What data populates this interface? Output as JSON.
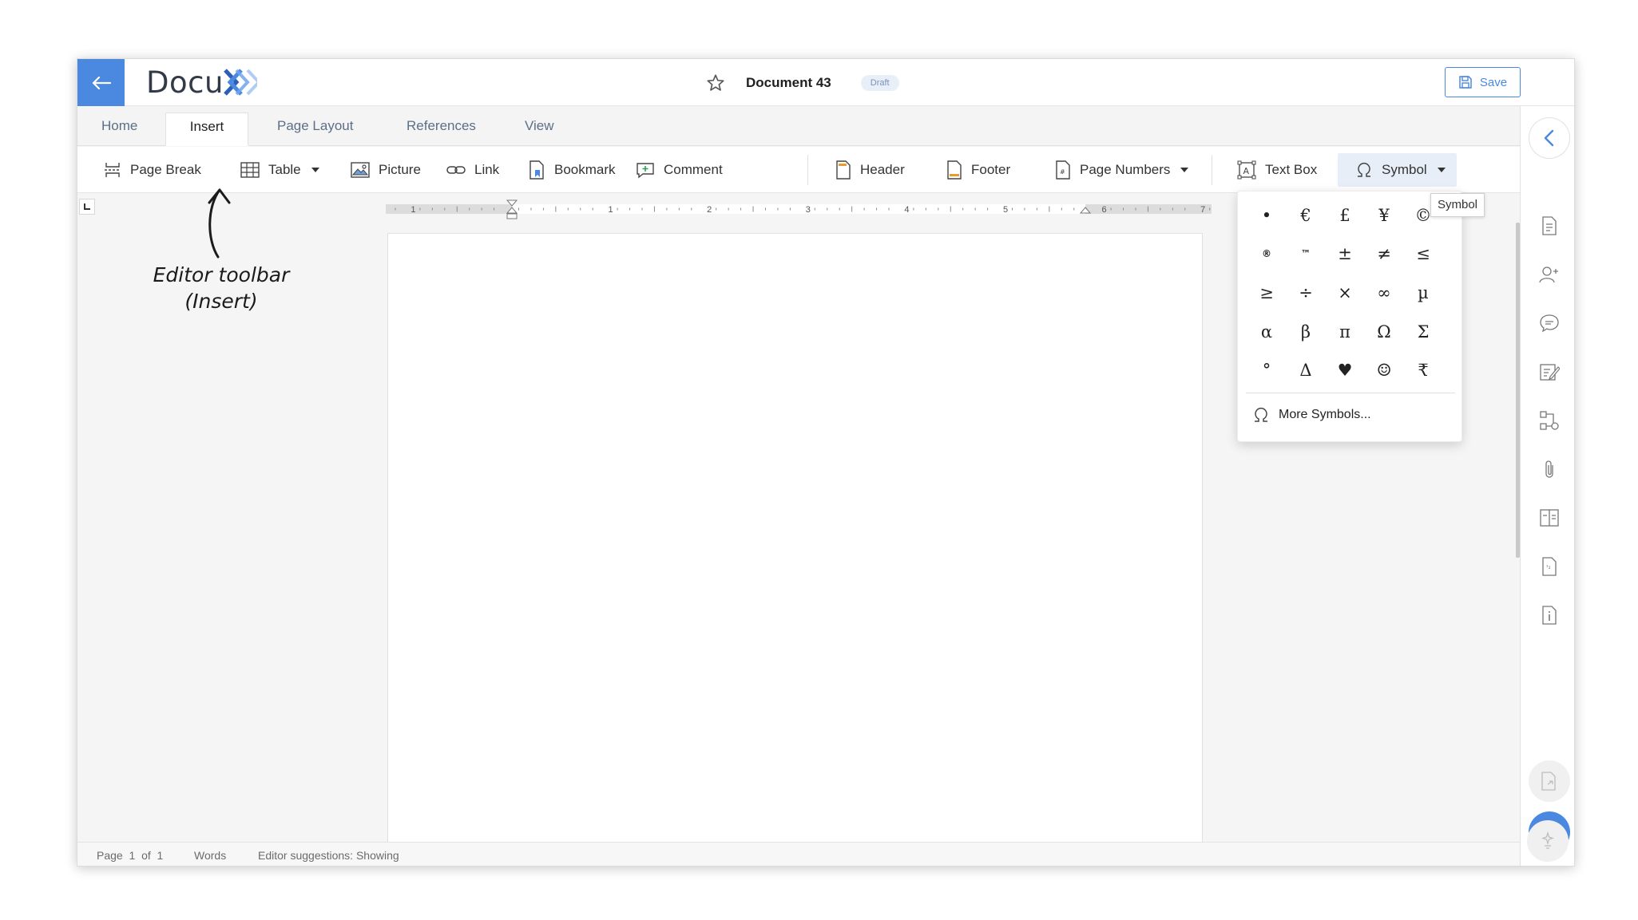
{
  "app": {
    "logo_text": "Docu",
    "document_title": "Document 43",
    "status_badge": "Draft",
    "save_label": "Save",
    "accent_color": "#4b88e0"
  },
  "tabs": [
    {
      "label": "Home",
      "active": false
    },
    {
      "label": "Insert",
      "active": true
    },
    {
      "label": "Page Layout",
      "active": false
    },
    {
      "label": "References",
      "active": false
    },
    {
      "label": "View",
      "active": false
    }
  ],
  "toolbar": {
    "page_break": "Page Break",
    "table": "Table",
    "picture": "Picture",
    "link": "Link",
    "bookmark": "Bookmark",
    "comment": "Comment",
    "header": "Header",
    "footer": "Footer",
    "page_numbers": "Page Numbers",
    "text_box": "Text Box",
    "symbol": "Symbol"
  },
  "ruler": {
    "numbers": [
      "1",
      "1",
      "2",
      "3",
      "4",
      "5",
      "6",
      "7"
    ]
  },
  "annotation": {
    "line1": "Editor toolbar",
    "line2": "(Insert)"
  },
  "symbol_menu": {
    "tooltip": "Symbol",
    "symbols": [
      "•",
      "€",
      "£",
      "¥",
      "©",
      "®",
      "™",
      "±",
      "≠",
      "≤",
      "≥",
      "÷",
      "×",
      "∞",
      "µ",
      "α",
      "β",
      "π",
      "Ω",
      "Σ",
      "°",
      "Δ",
      "♥",
      "☺",
      "₹"
    ],
    "more_label": "More Symbols..."
  },
  "right_rail": {
    "icons": [
      "collapse-panel-icon",
      "document-stats-icon",
      "add-user-icon",
      "comments-icon",
      "edit-checklist-icon",
      "workflow-icon",
      "attachment-icon",
      "compare-icon",
      "numbering-icon",
      "document-info-icon",
      "export-icon",
      "lock-document-icon",
      "ai-assistant-icon"
    ]
  },
  "status_bar": {
    "page_label": "Page",
    "page_current": "1",
    "page_of": "of",
    "page_total": "1",
    "words_label": "Words",
    "suggestions": "Editor suggestions: Showing"
  }
}
